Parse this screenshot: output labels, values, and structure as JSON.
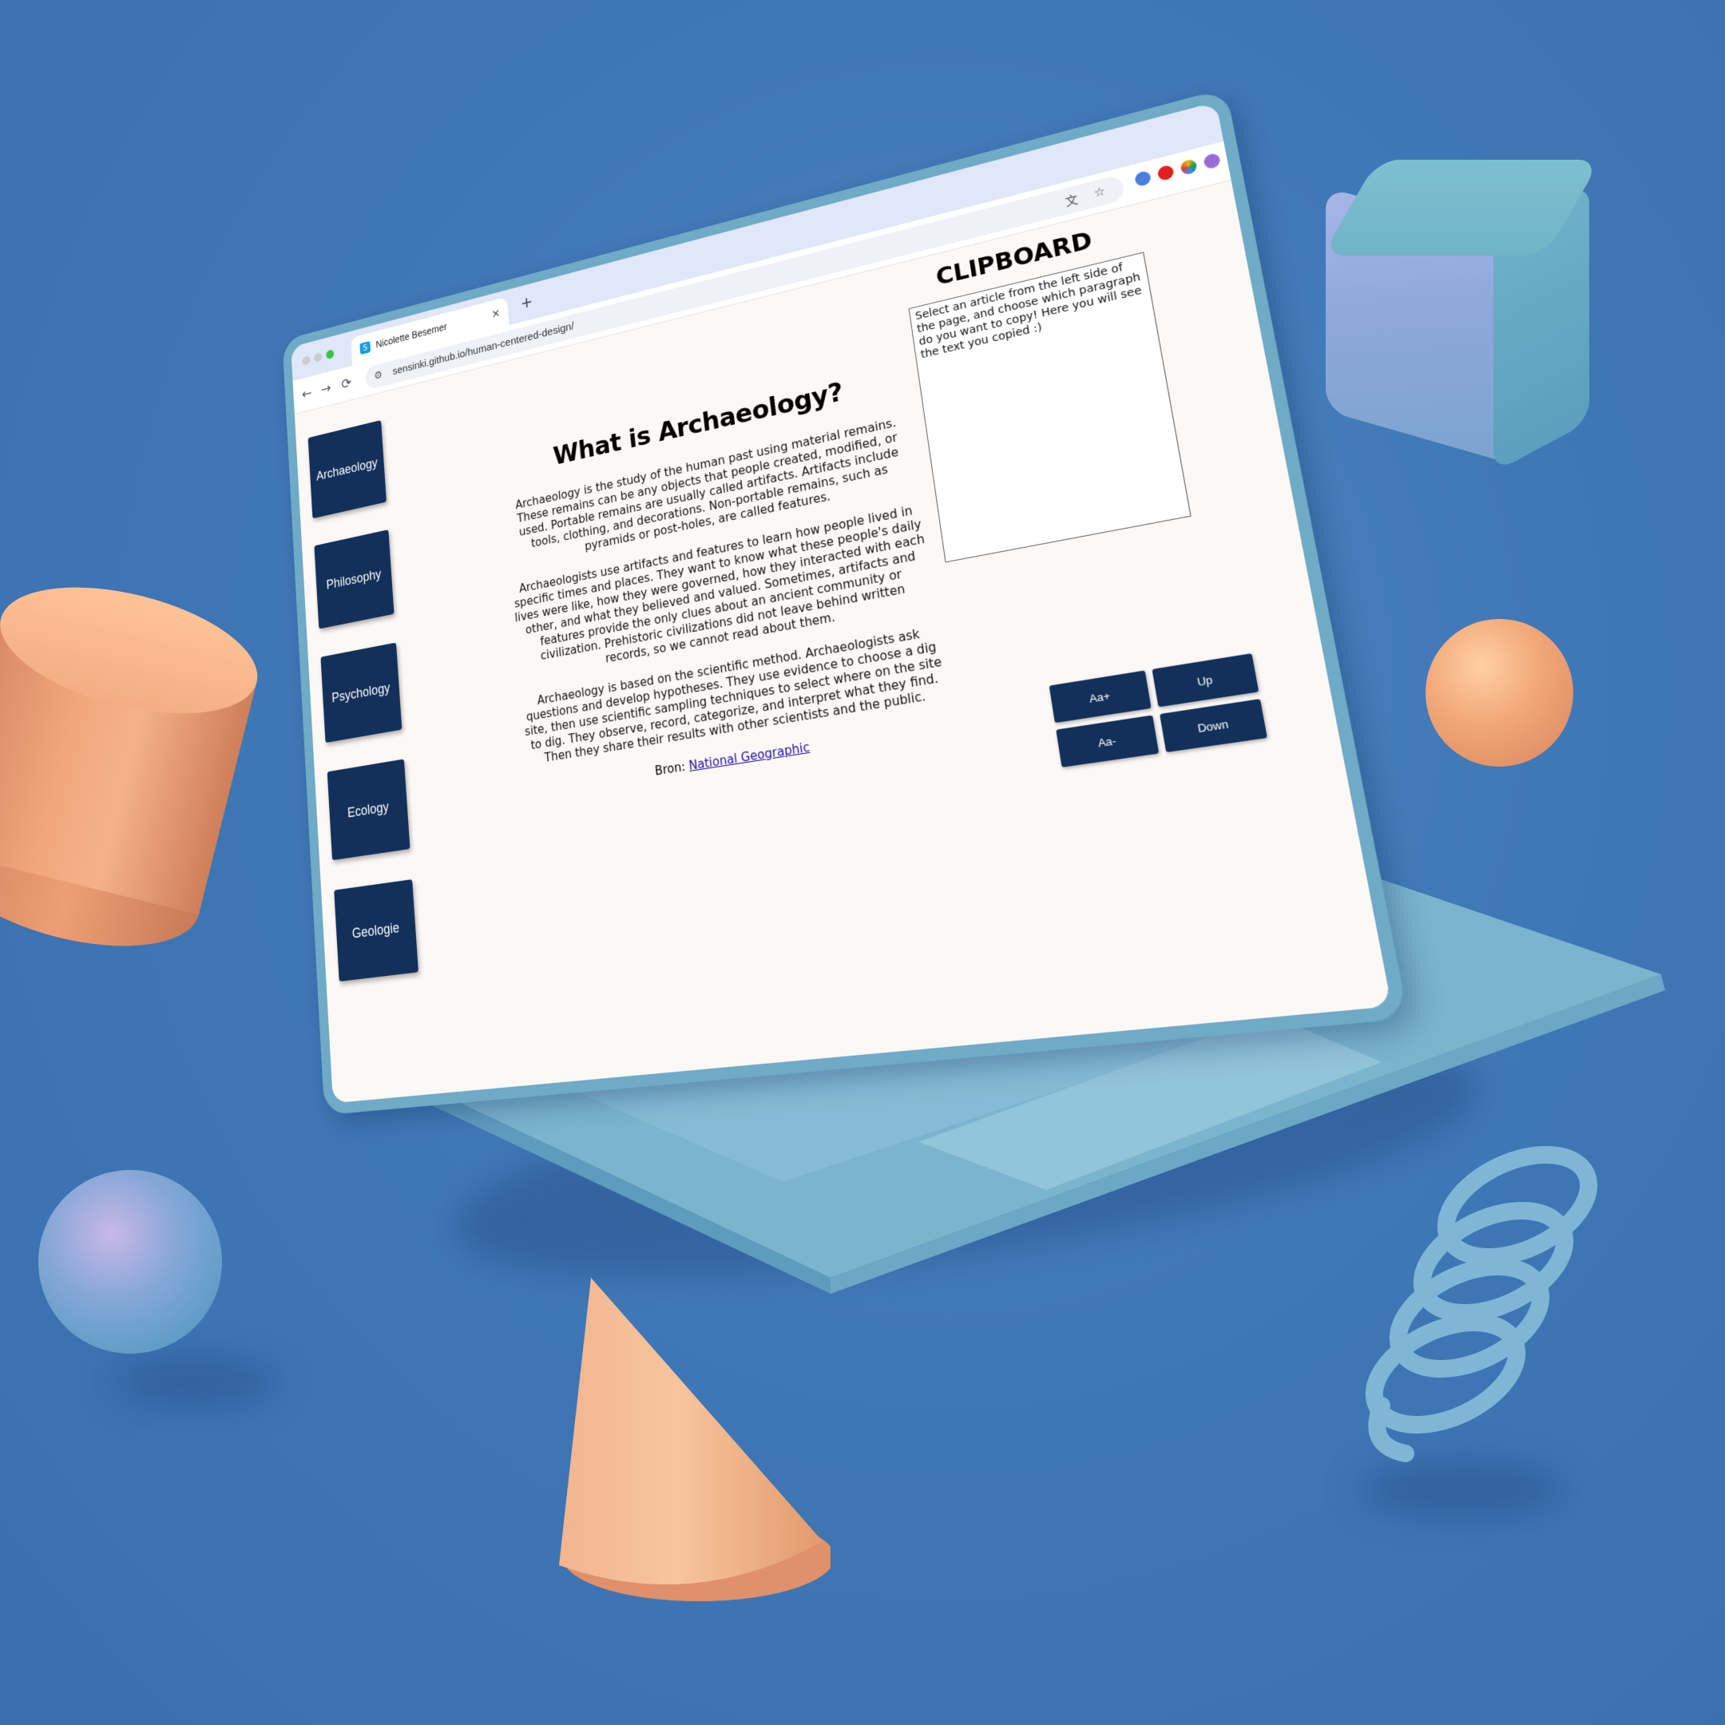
{
  "browser": {
    "tab_title": "Nicolette Besemer",
    "tab_close": "×",
    "new_tab": "+",
    "favicon": "S",
    "url": "sensinki.github.io/human-centered-design/",
    "back_icon": "←",
    "forward_icon": "→",
    "reload_icon": "⟳",
    "site_info_icon": "⚙",
    "star_icon": "☆",
    "translate_icon": "文"
  },
  "sidebar": {
    "items": [
      {
        "label": "Archaeology"
      },
      {
        "label": "Philosophy"
      },
      {
        "label": "Psychology"
      },
      {
        "label": "Ecology"
      },
      {
        "label": "Geologie"
      }
    ]
  },
  "article": {
    "title": "What is Archaeology?",
    "paragraphs": [
      "Archaeology is the study of the human past using material remains. These remains can be any objects that people created, modified, or used. Portable remains are usually called artifacts. Artifacts include tools, clothing, and decorations. Non-portable remains, such as pyramids or post-holes, are called features.",
      "Archaeologists use artifacts and features to learn how people lived in specific times and places. They want to know what these people's daily lives were like, how they were governed, how they interacted with each other, and what they believed and valued. Sometimes, artifacts and features provide the only clues about an ancient community or civilization. Prehistoric civilizations did not leave behind written records, so we cannot read about them.",
      "Archaeology is based on the scientific method. Archaeologists ask questions and develop hypotheses. They use evidence to choose a dig site, then use scientific sampling techniques to select where on the site to dig. They observe, record, categorize, and interpret what they find. Then they share their results with other scientists and the public."
    ],
    "source_label": "Bron:",
    "source_link": "National Geographic"
  },
  "clipboard": {
    "title": "CLIPBOARD",
    "text": "Select an article from the left side of the page, and choose which paragraph do you want to copy! Here you will see the text you copied :)"
  },
  "controls": {
    "font_up": "Aa+",
    "font_down": "Aa-",
    "up": "Up",
    "down": "Down"
  },
  "colors": {
    "background": "#3f78b6",
    "button_navy": "#13305a",
    "laptop_teal": "#6faac6",
    "page_bg": "#fcf8f5",
    "shape_orange": "#f3aa7b"
  }
}
